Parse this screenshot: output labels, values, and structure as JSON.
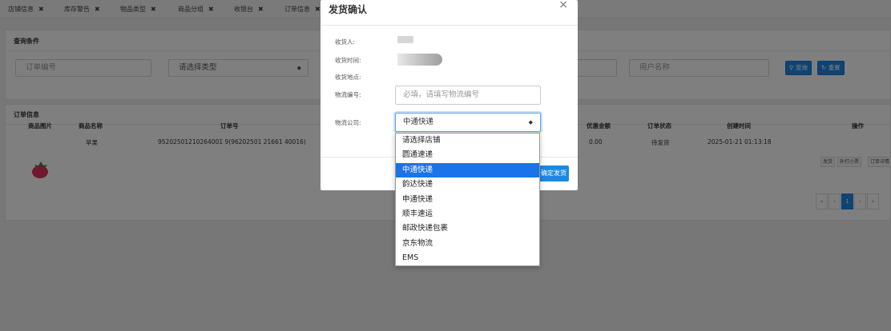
{
  "tabs": [
    {
      "label": "店铺信息",
      "close": "✖"
    },
    {
      "label": "库存警告",
      "close": "✖"
    },
    {
      "label": "物品类型",
      "close": "✖"
    },
    {
      "label": "商品分组",
      "close": "✖"
    },
    {
      "label": "收银台",
      "close": "✖"
    },
    {
      "label": "订单信息",
      "close": "✖"
    }
  ],
  "query": {
    "title": "查询条件",
    "order_no_placeholder": "订单编号",
    "type_select": "请选择类型",
    "username_placeholder": "用户名称",
    "search_label": "查询",
    "reset_label": "重置"
  },
  "orders": {
    "title": "订单信息",
    "headers": [
      "商品图片",
      "商品名称",
      "订单号",
      "优惠金额",
      "订单状态",
      "创建时间",
      "操作"
    ],
    "row": {
      "name": "苹果",
      "order_no": "95202501210264001 9(96202501 21661 40016)",
      "discount": "0.00",
      "status": "待发货",
      "created": "2025-01-21 01:13:18",
      "actions": [
        "发货",
        "补打小票",
        "订单详情"
      ]
    },
    "pager": [
      "«",
      "‹",
      "1",
      "›",
      "»"
    ]
  },
  "modal": {
    "title": "发货确认",
    "close": "×",
    "receiver_label": "收货人:",
    "time_label": "收货时间:",
    "address_label": "收货地点:",
    "tracking_label": "物流编号:",
    "tracking_placeholder": "必填，请填写物流编号",
    "company_label": "物流公司:",
    "company_value": "中通快递",
    "confirm_label": "确定发货"
  },
  "dropdown": {
    "options": [
      "请选择店铺",
      "圆通速递",
      "中通快递",
      "韵达快递",
      "申通快递",
      "顺丰速运",
      "邮政快递包裹",
      "京东物流",
      "EMS"
    ],
    "selected": "中通快递"
  },
  "colors": {
    "accent": "#1e88e5",
    "selected_option": "#1a73e8"
  },
  "icons": {
    "search": "search-icon",
    "reset": "refresh-icon",
    "close": "close-icon",
    "product": "fruit-icon"
  }
}
